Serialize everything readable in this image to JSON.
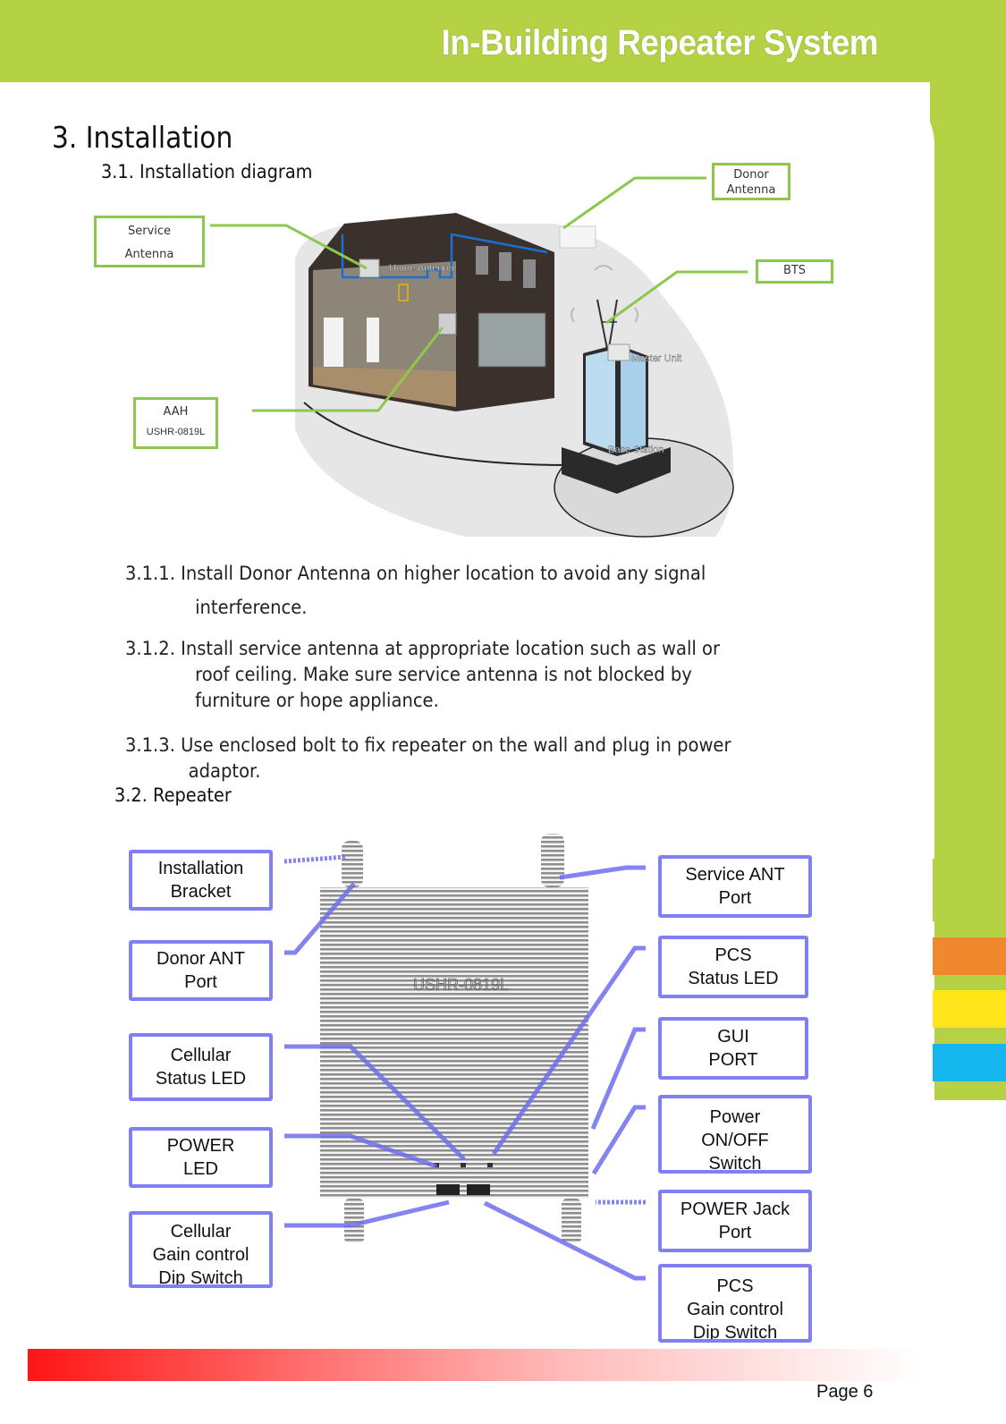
{
  "header": {
    "title": "In-Building Repeater System"
  },
  "section": {
    "title": "3. Installation",
    "subsections": [
      {
        "title": "3.1. Installation diagram"
      },
      {
        "title": "3.2. Repeater"
      }
    ]
  },
  "diagram": {
    "callouts": {
      "service_antenna": [
        "Service",
        "Antenna"
      ],
      "donor_antenna": [
        "Donor",
        "Antenna"
      ],
      "bts": "BTS",
      "aah": [
        "AAH",
        "USHR-0819L"
      ]
    },
    "embedded_labels": {
      "home_antenna": "Home Antenna",
      "master_unit": "Master Unit",
      "base_station": "Base Station"
    },
    "colors": {
      "callout": "#8dc84d",
      "cable": "#1a6fd1"
    }
  },
  "instructions": [
    {
      "num": "3.1.1.",
      "lines": [
        "Install Donor Antenna on higher location to avoid any signal",
        "interference."
      ]
    },
    {
      "num": "3.1.2.",
      "lines": [
        "Install service antenna at appropriate location such as wall or",
        "roof ceiling. Make sure service antenna is not blocked by",
        "furniture or hope appliance."
      ]
    },
    {
      "num": "3.1.3.",
      "lines": [
        "Use enclosed bolt to fix repeater on the wall and plug in power",
        "adaptor."
      ]
    }
  ],
  "repeater": {
    "model": "USHR-0819L",
    "left_labels": [
      {
        "id": "installation-bracket",
        "lines": [
          "Installation",
          "Bracket"
        ]
      },
      {
        "id": "donor-ant-port",
        "lines": [
          "Donor ANT",
          "Port"
        ]
      },
      {
        "id": "cellular-status-led",
        "lines": [
          "Cellular",
          "Status LED"
        ]
      },
      {
        "id": "power-led",
        "lines": [
          "POWER",
          "LED"
        ]
      },
      {
        "id": "cellular-gain-dip",
        "lines": [
          "Cellular",
          "Gain control",
          "Dip Switch"
        ]
      }
    ],
    "right_labels": [
      {
        "id": "service-ant-port",
        "lines": [
          "Service ANT",
          "Port"
        ]
      },
      {
        "id": "pcs-status-led",
        "lines": [
          "PCS",
          "Status LED"
        ]
      },
      {
        "id": "gui-port",
        "lines": [
          "GUI",
          "PORT"
        ]
      },
      {
        "id": "power-switch",
        "lines": [
          "Power",
          "ON/OFF",
          "Switch"
        ]
      },
      {
        "id": "power-jack-port",
        "lines": [
          "POWER Jack",
          "Port"
        ]
      },
      {
        "id": "pcs-gain-dip",
        "lines": [
          "PCS",
          "Gain control",
          "Dip Switch"
        ]
      }
    ],
    "colors": {
      "leader": "#6d6df0"
    }
  },
  "side_swatches": [
    "#b5d244",
    "#f0892e",
    "#ffe51a",
    "#16b6ee"
  ],
  "footer": {
    "page": "Page 6"
  }
}
